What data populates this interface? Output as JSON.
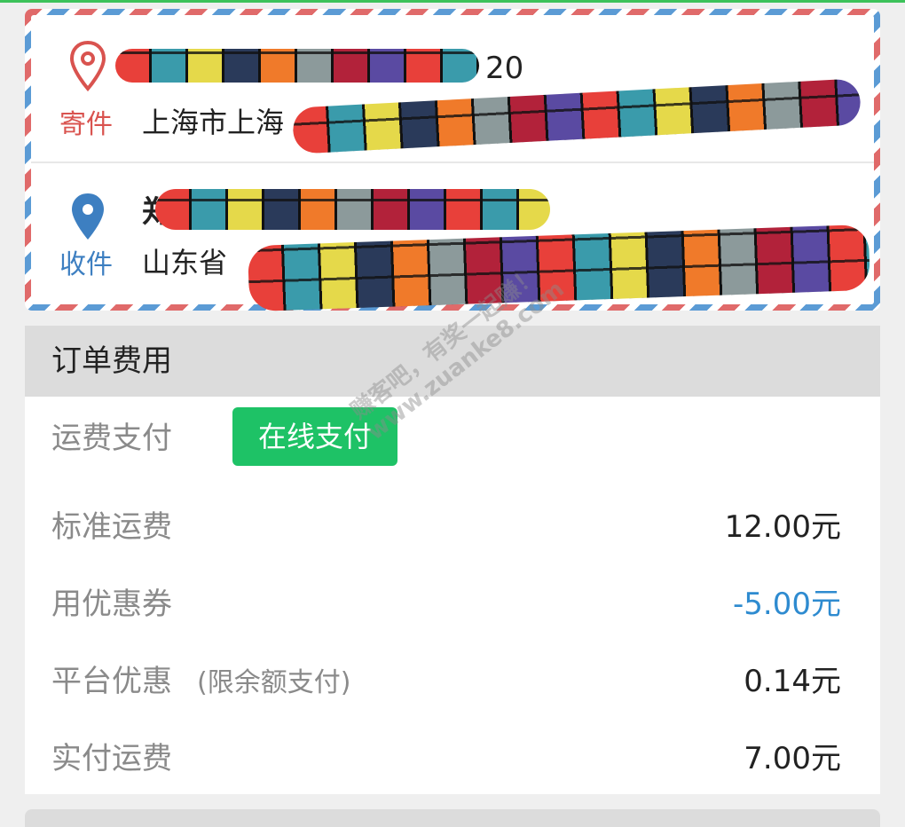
{
  "sender": {
    "tag": "寄件",
    "name_visible": "20",
    "address_visible": "上海市上海"
  },
  "receiver": {
    "tag": "收件",
    "name_visible": "郑",
    "address_visible": "山东省"
  },
  "fees": {
    "title": "订单费用",
    "payment_label": "运费支付",
    "payment_button": "在线支付",
    "rows": [
      {
        "label": "标准运费",
        "value": "12.00元"
      },
      {
        "label": "用优惠券",
        "value": "-5.00元"
      },
      {
        "label": "平台优惠",
        "note": "(限余额支付)",
        "value": "0.14元"
      },
      {
        "label": "实付运费",
        "value": "7.00元"
      }
    ]
  },
  "watermark": {
    "line1": "赚客吧，有奖一起赚！",
    "line2": "www.zuanke8.com"
  },
  "colors": {
    "sender": "#d9534f",
    "receiver": "#3d7fc1",
    "pay_button": "#1ec266",
    "discount": "#2e8bd0"
  },
  "icons": {
    "sender_pin": "location-pin-outline-icon",
    "receiver_pin": "location-pin-filled-icon"
  }
}
